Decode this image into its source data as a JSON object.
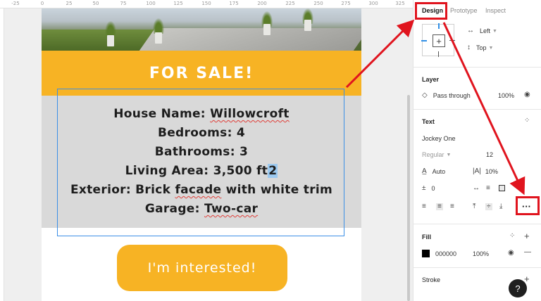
{
  "ruler": {
    "ticks": [
      "-25",
      "0",
      "25",
      "50",
      "75",
      "100",
      "125",
      "150",
      "175",
      "200",
      "225",
      "250",
      "275",
      "300",
      "325"
    ]
  },
  "design": {
    "banner_title": "FOR SALE!",
    "details": {
      "l1_prefix": "House Name: ",
      "l1_name": "Willowcroft",
      "l2": "Bedrooms: 4",
      "l3": "Bathrooms: 3",
      "l4_prefix": "Living Area: 3,500 ft",
      "l4_caret": "2",
      "l5_a": "Exterior: Brick ",
      "l5_facade": "facade",
      "l5_b": " with white trim",
      "l6_a": "Garage: ",
      "l6_two": "Two-car"
    },
    "cta_label": "I'm interested!"
  },
  "panel": {
    "tabs": {
      "design": "Design",
      "prototype": "Prototype",
      "inspect": "Inspect"
    },
    "constraints": {
      "h": "Left",
      "v": "Top"
    },
    "layer": {
      "title": "Layer",
      "blend": "Pass through",
      "opacity": "100%"
    },
    "text": {
      "title": "Text",
      "font": "Jockey One",
      "weight": "Regular",
      "size": "12",
      "line_height": "Auto",
      "letter_spacing": "10%",
      "paragraph_spacing": "0"
    },
    "fill": {
      "title": "Fill",
      "hex": "000000",
      "opacity": "100%",
      "color": "#000000"
    },
    "stroke": {
      "title": "Stroke"
    }
  },
  "help": {
    "label": "?"
  },
  "colors": {
    "accent": "#f7b324",
    "annotation": "#e0141e",
    "selection": "#3b8ee6"
  }
}
